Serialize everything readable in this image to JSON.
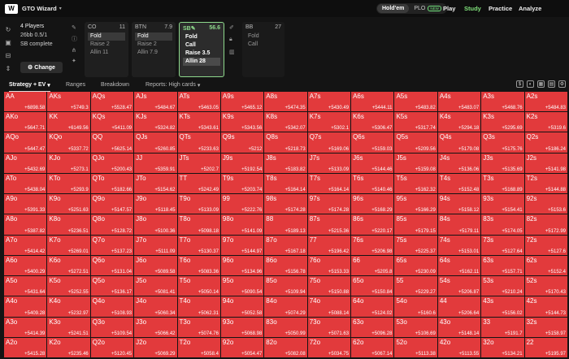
{
  "app": {
    "name": "GTO Wizard",
    "logo": "W"
  },
  "game_modes": [
    {
      "label": "Hold'em",
      "active": true
    },
    {
      "label": "PLO",
      "badge": "NEW",
      "active": false
    }
  ],
  "nav": [
    {
      "label": "Play",
      "active": false
    },
    {
      "label": "Study",
      "active": true
    },
    {
      "label": "Practice",
      "active": false
    },
    {
      "label": "Analyze",
      "active": false
    }
  ],
  "info": {
    "players": "4 Players",
    "stack": "26bb 0.5/1",
    "status": "SB complete",
    "change_label": "Change"
  },
  "positions": [
    {
      "name": "CO",
      "stack": "11",
      "options": [
        "Fold",
        "Raise 2",
        "Allin 11"
      ],
      "selected": 0
    },
    {
      "name": "BTN",
      "stack": "7.9",
      "options": [
        "Fold",
        "Raise 2",
        "Allin 7.9"
      ],
      "selected": 0
    },
    {
      "name": "SB",
      "stack": "56.6",
      "options": [
        "Fold",
        "Call",
        "Raise 3.5",
        "Allin 28"
      ],
      "selected": 3,
      "highlight": true
    },
    {
      "name": "BB",
      "stack": "27",
      "options": [
        "Fold",
        "Call"
      ],
      "selected": -1
    }
  ],
  "tabs": {
    "strategy": "Strategy + EV",
    "ranges": "Ranges",
    "breakdown": "Breakdown",
    "reports": "Reports: High cards"
  },
  "colors": {
    "allin": "#e23a3c",
    "fold": "#8b1e22",
    "accent": "#8ed98c"
  },
  "grid": [
    [
      [
        "AA",
        "+6898.58",
        1.0
      ],
      [
        "AKs",
        "+5749.3",
        1.0
      ],
      [
        "AQs",
        "+5528.47",
        1.0
      ],
      [
        "AJs",
        "+5484.67",
        1.0
      ],
      [
        "ATs",
        "+5463.05",
        1.0
      ],
      [
        "A9s",
        "+5465.12",
        1.0
      ],
      [
        "A8s",
        "+5474.35",
        1.0
      ],
      [
        "A7s",
        "+5430.49",
        1.0
      ],
      [
        "A6s",
        "+5444.11",
        1.0
      ],
      [
        "A5s",
        "+5483.82",
        1.0
      ],
      [
        "A4s",
        "+5483.07",
        1.0
      ],
      [
        "A3s",
        "+5468.76",
        1.0
      ],
      [
        "A2s",
        "+5484.83",
        1.0
      ]
    ],
    [
      [
        "AKo",
        "+5647.71",
        1.0
      ],
      [
        "KK",
        "+6149.56",
        1.0
      ],
      [
        "KQs",
        "+5411.09",
        1.0
      ],
      [
        "KJs",
        "+5324.82",
        1.0
      ],
      [
        "KTs",
        "+5343.61",
        1.0
      ],
      [
        "K9s",
        "+5343.56",
        1.0
      ],
      [
        "K8s",
        "+5342.07",
        1.0
      ],
      [
        "K7s",
        "+5302.1",
        1.0
      ],
      [
        "K6s",
        "+5306.47",
        1.0
      ],
      [
        "K5s",
        "+5317.74",
        1.0
      ],
      [
        "K4s",
        "+5294.18",
        1.0
      ],
      [
        "K3s",
        "+5295.69",
        1.0
      ],
      [
        "K2s",
        "+5319.6",
        1.0
      ]
    ],
    [
      [
        "AQo",
        "+5447.47",
        1.0
      ],
      [
        "KQo",
        "+5337.72",
        1.0
      ],
      [
        "QQ",
        "+5625.14",
        1.0
      ],
      [
        "QJs",
        "+5260.85",
        1.0
      ],
      [
        "QTs",
        "+5233.63",
        1.0
      ],
      [
        "Q9s",
        "+5212",
        1.0
      ],
      [
        "Q8s",
        "+5218.73",
        1.0
      ],
      [
        "Q7s",
        "+5169.06",
        1.0
      ],
      [
        "Q6s",
        "+5159.03",
        1.0
      ],
      [
        "Q5s",
        "+5209.56",
        1.0
      ],
      [
        "Q4s",
        "+5179.08",
        1.0
      ],
      [
        "Q3s",
        "+5175.76",
        1.0
      ],
      [
        "Q2s",
        "+5186.24",
        1.0
      ]
    ],
    [
      [
        "AJo",
        "+5432.69",
        1.0
      ],
      [
        "KJo",
        "+5273.1",
        1.0
      ],
      [
        "QJo",
        "+5200.43",
        1.0
      ],
      [
        "JJ",
        "+5359.91",
        1.0
      ],
      [
        "JTs",
        "+5202.7",
        1.0
      ],
      [
        "J9s",
        "+5192.54",
        1.0
      ],
      [
        "J8s",
        "+5183.82",
        1.0
      ],
      [
        "J7s",
        "+5133.09",
        1.0
      ],
      [
        "J6s",
        "+5144.46",
        1.0
      ],
      [
        "J5s",
        "+5159.08",
        1.0
      ],
      [
        "J4s",
        "+5136.06",
        1.0
      ],
      [
        "J3s",
        "+5135.69",
        1.0
      ],
      [
        "J2s",
        "+5141.98",
        1.0
      ]
    ],
    [
      [
        "ATo",
        "+5438.04",
        1.0
      ],
      [
        "KTo",
        "+5293.9",
        1.0
      ],
      [
        "QTo",
        "+5182.66",
        1.0
      ],
      [
        "JTo",
        "+5154.62",
        1.0
      ],
      [
        "TT",
        "+5242.49",
        1.0
      ],
      [
        "T9s",
        "+5203.74",
        1.0
      ],
      [
        "T8s",
        "+5164.14",
        1.0
      ],
      [
        "T7s",
        "+5164.14",
        1.0
      ],
      [
        "T6s",
        "+5140.46",
        1.0
      ],
      [
        "T5s",
        "+5162.32",
        1.0
      ],
      [
        "T4s",
        "+5152.48",
        1.0
      ],
      [
        "T3s",
        "+5168.89",
        1.0
      ],
      [
        "T2s",
        "+5144.88",
        1.0
      ]
    ],
    [
      [
        "A9o",
        "+5391.33",
        1.0
      ],
      [
        "K9o",
        "+5251.63",
        1.0
      ],
      [
        "Q9o",
        "+5147.57",
        1.0
      ],
      [
        "J9o",
        "+5118.45",
        1.0
      ],
      [
        "T9o",
        "+5133.09",
        1.0
      ],
      [
        "99",
        "+5222.76",
        1.0
      ],
      [
        "98s",
        "+5174.28",
        1.0
      ],
      [
        "97s",
        "+5174.28",
        1.0
      ],
      [
        "96s",
        "+5168.29",
        1.0
      ],
      [
        "95s",
        "+5166.29",
        1.0
      ],
      [
        "94s",
        "+5158.12",
        1.0
      ],
      [
        "93s",
        "+5154.41",
        1.0
      ],
      [
        "92s",
        "+5153.6",
        1.0
      ]
    ],
    [
      [
        "A8o",
        "+5387.82",
        1.0
      ],
      [
        "K8o",
        "+5236.51",
        1.0
      ],
      [
        "Q8o",
        "+5128.72",
        1.0
      ],
      [
        "J8o",
        "+5100.36",
        1.0
      ],
      [
        "T8o",
        "+5098.18",
        1.0
      ],
      [
        "98o",
        "+5141.09",
        1.0
      ],
      [
        "88",
        "+5189.13",
        1.0
      ],
      [
        "87s",
        "+5215.36",
        1.0
      ],
      [
        "86s",
        "+5220.17",
        1.0
      ],
      [
        "85s",
        "+5179.15",
        1.0
      ],
      [
        "84s",
        "+5179.11",
        1.0
      ],
      [
        "83s",
        "+5174.05",
        1.0
      ],
      [
        "82s",
        "+5172.99",
        1.0
      ]
    ],
    [
      [
        "A7o",
        "+5414.42",
        1.0
      ],
      [
        "K7o",
        "+5269.01",
        1.0
      ],
      [
        "Q7o",
        "+5137.23",
        1.0
      ],
      [
        "J7o",
        "+5111.09",
        1.0
      ],
      [
        "T7o",
        "+5130.37",
        1.0
      ],
      [
        "97o",
        "+5144.97",
        1.0
      ],
      [
        "87o",
        "+5167.18",
        1.0
      ],
      [
        "77",
        "+5196.42",
        1.0
      ],
      [
        "76s",
        "+5206.98",
        1.0
      ],
      [
        "75s",
        "+5225.37",
        1.0
      ],
      [
        "74s",
        "+5153.01",
        1.0
      ],
      [
        "73s",
        "+5127.64",
        1.0
      ],
      [
        "72s",
        "+5127.6",
        1.0
      ]
    ],
    [
      [
        "A6o",
        "+5400.29",
        1.0
      ],
      [
        "K6o",
        "+5272.51",
        1.0
      ],
      [
        "Q6o",
        "+5131.04",
        1.0
      ],
      [
        "J6o",
        "+5089.58",
        1.0
      ],
      [
        "T6o",
        "+5083.36",
        1.0
      ],
      [
        "96o",
        "+5134.96",
        1.0
      ],
      [
        "86o",
        "+5156.78",
        1.0
      ],
      [
        "76o",
        "+5153.33",
        1.0
      ],
      [
        "66",
        "+5205.8",
        1.0
      ],
      [
        "65s",
        "+5230.09",
        1.0
      ],
      [
        "64s",
        "+5162.11",
        1.0
      ],
      [
        "63s",
        "+5157.71",
        1.0
      ],
      [
        "62s",
        "+5152.4",
        1.0
      ]
    ],
    [
      [
        "A5o",
        "+5431.64",
        1.0
      ],
      [
        "K5o",
        "+5252.55",
        1.0
      ],
      [
        "Q5o",
        "+5136.17",
        1.0
      ],
      [
        "J5o",
        "+5081.41",
        1.0
      ],
      [
        "T5o",
        "+5050.14",
        1.0
      ],
      [
        "95o",
        "+5090.54",
        1.0
      ],
      [
        "85o",
        "+5109.94",
        1.0
      ],
      [
        "75o",
        "+5150.88",
        1.0
      ],
      [
        "65o",
        "+5150.84",
        1.0
      ],
      [
        "55",
        "+5229.27",
        1.0
      ],
      [
        "54s",
        "+5206.87",
        1.0
      ],
      [
        "53s",
        "+5210.24",
        1.0
      ],
      [
        "52s",
        "+5170.43",
        1.0
      ]
    ],
    [
      [
        "A4o",
        "+5409.28",
        1.0
      ],
      [
        "K4o",
        "+5232.97",
        1.0
      ],
      [
        "Q4o",
        "+5108.93",
        1.0
      ],
      [
        "J4o",
        "+5060.34",
        1.0
      ],
      [
        "T4o",
        "+5062.31",
        1.0
      ],
      [
        "94o",
        "+5052.58",
        1.0
      ],
      [
        "84o",
        "+5074.29",
        1.0
      ],
      [
        "74o",
        "+5088.14",
        1.0
      ],
      [
        "64o",
        "+5124.02",
        1.0
      ],
      [
        "54o",
        "+5160.6",
        1.0
      ],
      [
        "44",
        "+5206.64",
        1.0
      ],
      [
        "43s",
        "+5156.02",
        1.0
      ],
      [
        "42s",
        "+5144.73",
        1.0
      ]
    ],
    [
      [
        "A3o",
        "+5414.39",
        1.0
      ],
      [
        "K3o",
        "+5241.51",
        1.0
      ],
      [
        "Q3o",
        "+5109.54",
        1.0
      ],
      [
        "J3o",
        "+5066.42",
        1.0
      ],
      [
        "T3o",
        "+5074.76",
        1.0
      ],
      [
        "93o",
        "+5068.98",
        1.0
      ],
      [
        "83o",
        "+5050.99",
        1.0
      ],
      [
        "73o",
        "+5071.63",
        1.0
      ],
      [
        "63o",
        "+5096.28",
        1.0
      ],
      [
        "53o",
        "+5106.69",
        1.0
      ],
      [
        "43o",
        "+5148.14",
        1.0
      ],
      [
        "33",
        "+5191.7",
        1.0
      ],
      [
        "32s",
        "+5158.97",
        1.0
      ]
    ],
    [
      [
        "A2o",
        "+5415.28",
        1.0
      ],
      [
        "K2o",
        "+5235.46",
        1.0
      ],
      [
        "Q2o",
        "+5120.45",
        1.0
      ],
      [
        "J2o",
        "+5069.29",
        1.0
      ],
      [
        "T2o",
        "+5058.4",
        1.0
      ],
      [
        "92o",
        "+5054.47",
        1.0
      ],
      [
        "82o",
        "+5082.08",
        1.0
      ],
      [
        "72o",
        "+5034.75",
        1.0
      ],
      [
        "62o",
        "+5067.14",
        1.0
      ],
      [
        "52o",
        "+5113.38",
        1.0
      ],
      [
        "42o",
        "+5113.55",
        1.0
      ],
      [
        "32o",
        "+5134.21",
        1.0
      ],
      [
        "22",
        "+5195.97",
        1.0
      ]
    ]
  ]
}
